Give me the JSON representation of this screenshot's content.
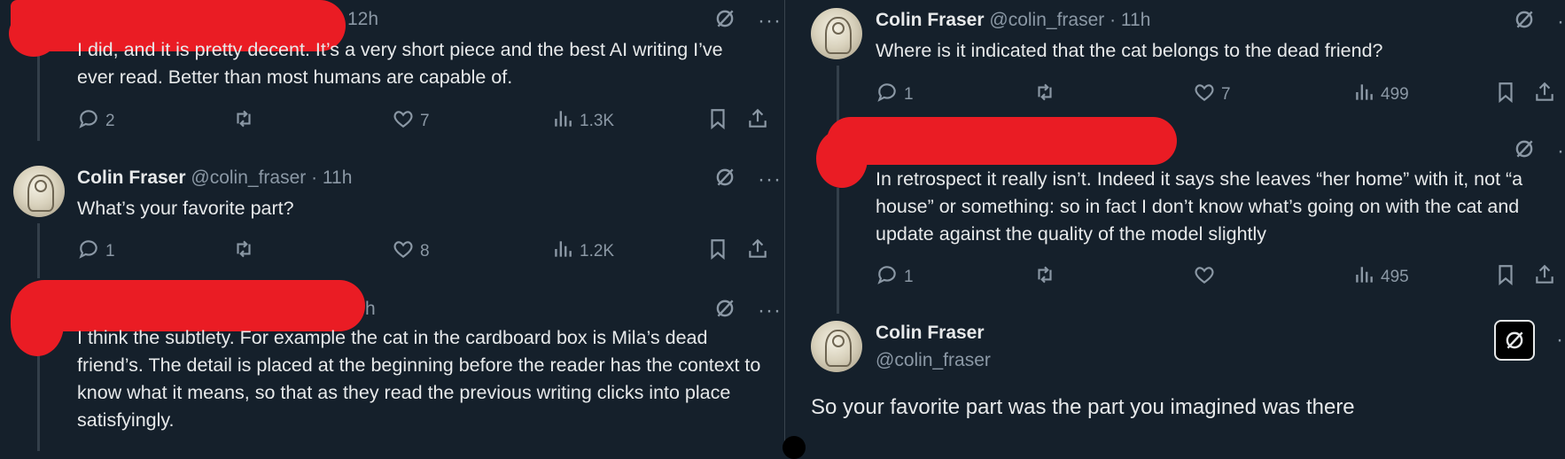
{
  "left": {
    "tweets": [
      {
        "time": "12h",
        "text": "I did, and it is pretty decent. It’s a very short piece and the best AI writing I’ve ever read. Better than most humans are capable of.",
        "replies": "2",
        "retweets": "",
        "likes": "7",
        "views": "1.3K"
      },
      {
        "name": "Colin Fraser",
        "handle": "@colin_fraser · 11h",
        "text": "What’s your favorite part?",
        "replies": "1",
        "retweets": "",
        "likes": "8",
        "views": "1.2K"
      },
      {
        "time": "h",
        "text": "I think the subtlety. For example the cat in the cardboard box is Mila’s dead friend’s. The detail is placed at the beginning before the reader has the context to know what it means, so that as they read the previous writing clicks into place satisfyingly."
      }
    ]
  },
  "right": {
    "tweets": [
      {
        "name": "Colin Fraser",
        "handle": "@colin_fraser · 11h",
        "text": "Where is it indicated that the cat belongs to the dead friend?",
        "replies": "1",
        "retweets": "",
        "likes": "7",
        "views": "499"
      },
      {
        "text": "In retrospect it really isn’t. Indeed it says she leaves “her home” with it, not “a house” or something: so in fact I don’t know what’s going on with the cat and update against the quality of the model slightly",
        "replies": "1",
        "retweets": "",
        "likes": "",
        "views": "495"
      }
    ],
    "main": {
      "name": "Colin Fraser",
      "handle": "@colin_fraser",
      "text": "So your favorite part was the part you imagined was there"
    }
  },
  "colors": {
    "background": "#15202b",
    "text": "#e7e9ea",
    "muted": "#8b98a5",
    "redaction": "#ea1c24"
  },
  "icons": [
    "reply-icon",
    "retweet-icon",
    "like-icon",
    "views-icon",
    "bookmark-icon",
    "share-icon",
    "grok-icon",
    "more-icon"
  ]
}
